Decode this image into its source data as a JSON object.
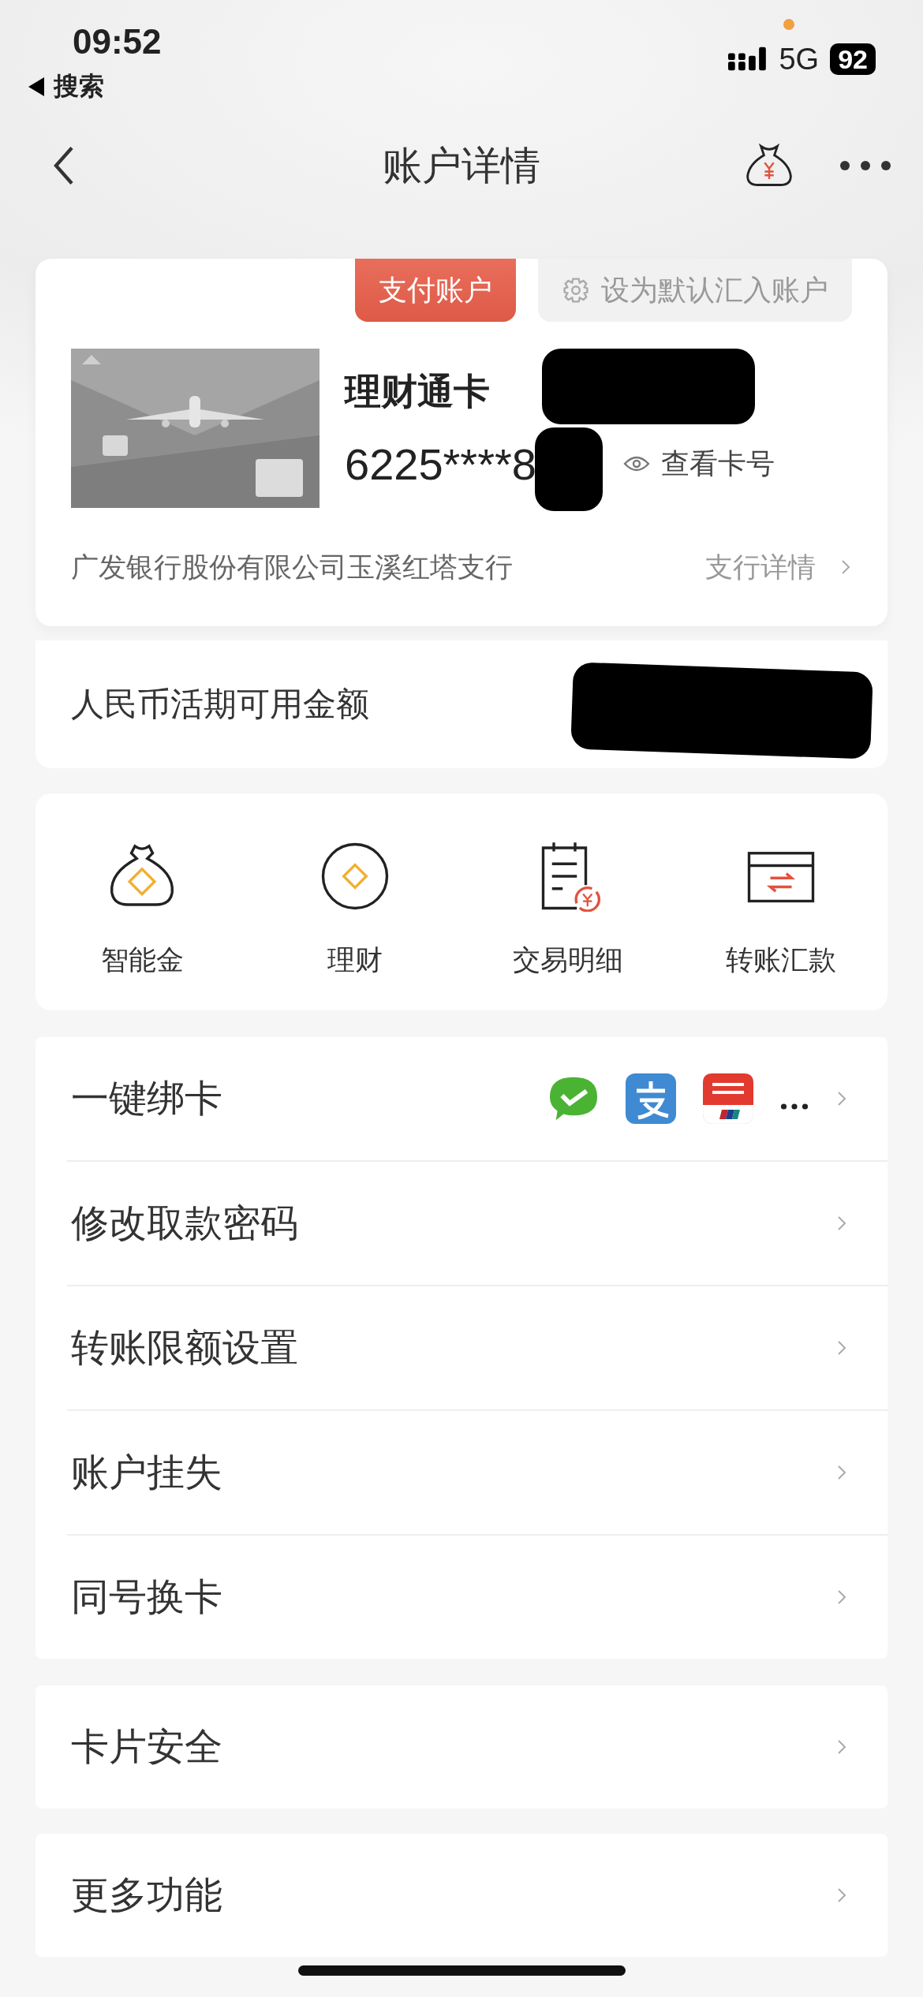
{
  "status_bar": {
    "time": "09:52",
    "back_app": "搜索",
    "network": "5G",
    "battery": "92"
  },
  "nav": {
    "title": "账户详情"
  },
  "account": {
    "tags": [
      {
        "label": "支付账户",
        "selected": true
      },
      {
        "label": "设为默认汇入账户",
        "selected": false
      }
    ],
    "card_name": {
      "text": "理财通卡",
      "redacted": true
    },
    "card_number": {
      "text": "6225****8",
      "redacted": true
    },
    "view_number": "查看卡号",
    "branch": "广发银行股份有限公司玉溪红塔支行",
    "branch_link": "支行详情"
  },
  "balance": {
    "label": "人民币活期可用金额",
    "redacted": true
  },
  "actions": [
    {
      "label": "智能金",
      "kind": "bag"
    },
    {
      "label": "理财",
      "kind": "coin"
    },
    {
      "label": "交易明细",
      "kind": "statement"
    },
    {
      "label": "转账汇款",
      "kind": "transfer"
    }
  ],
  "menu_groups": [
    [
      {
        "label": "一键绑卡",
        "kind": "bind"
      },
      {
        "label": "修改取款密码",
        "kind": "plain"
      },
      {
        "label": "转账限额设置",
        "kind": "plain"
      },
      {
        "label": "账户挂失",
        "kind": "plain"
      },
      {
        "label": "同号换卡",
        "kind": "plain"
      }
    ],
    [
      {
        "label": "卡片安全",
        "kind": "plain"
      }
    ],
    [
      {
        "label": "更多功能",
        "kind": "plain"
      }
    ]
  ]
}
